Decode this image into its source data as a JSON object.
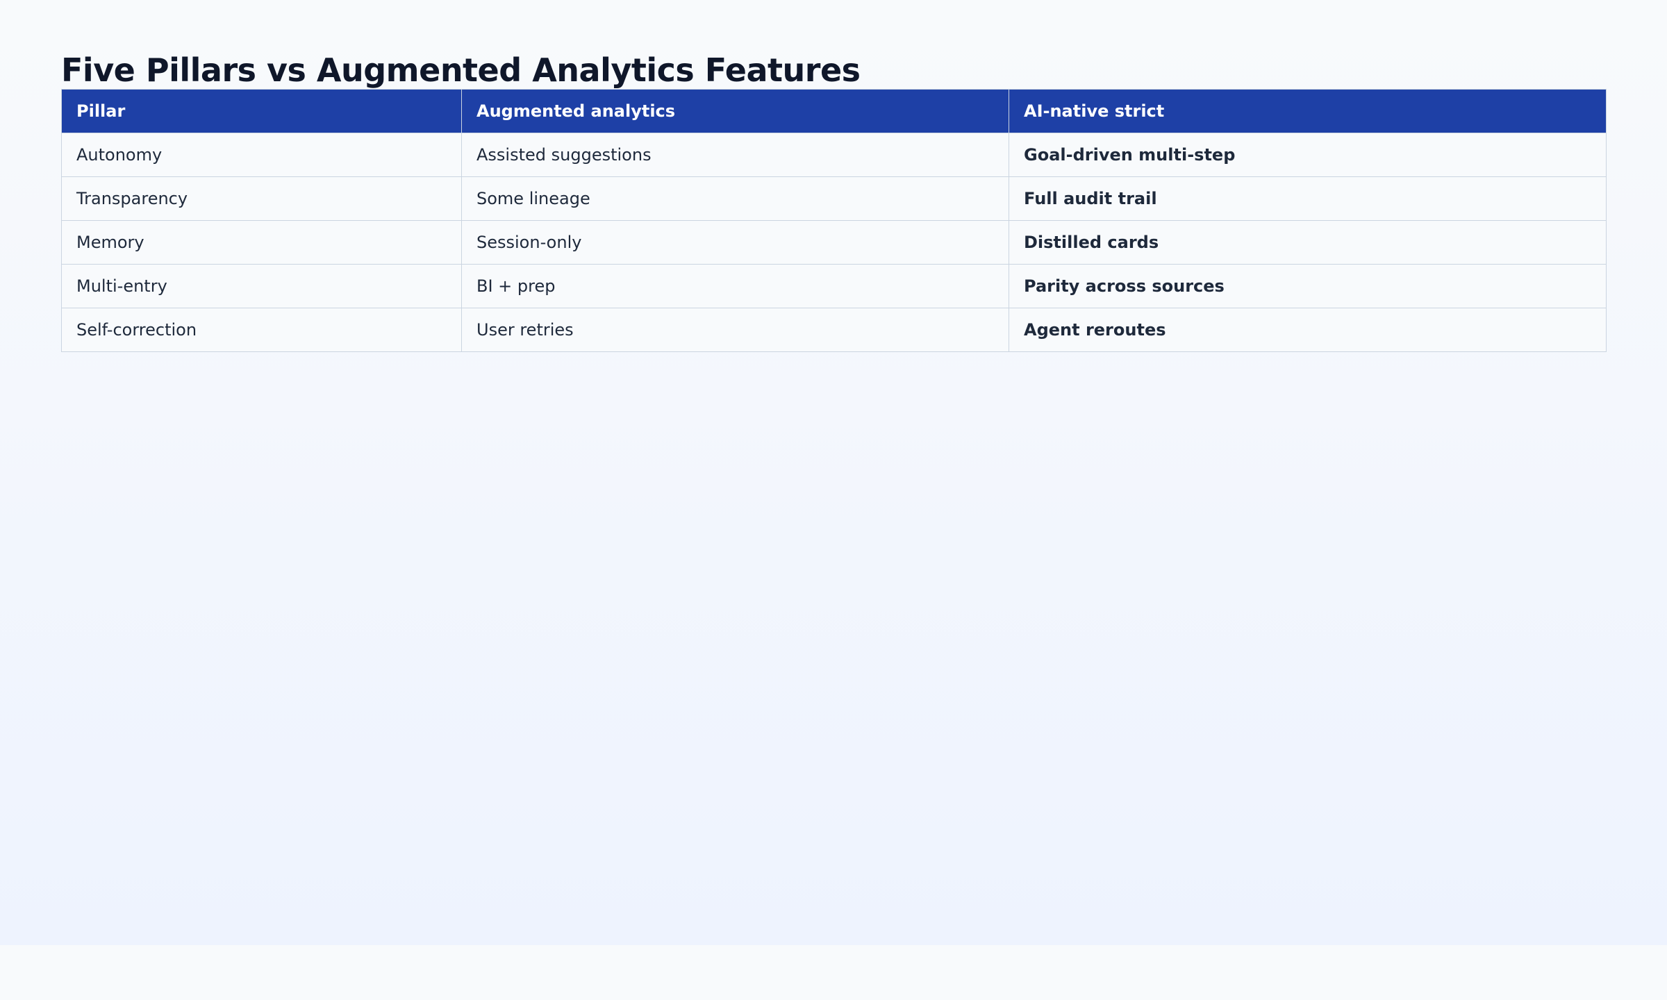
{
  "title": "Five Pillars vs Augmented Analytics Features",
  "columns": [
    "Pillar",
    "Augmented analytics",
    "AI-native strict"
  ],
  "rows": [
    {
      "pillar": "Autonomy",
      "augmented": "Assisted suggestions",
      "augmented_tone": "warn",
      "ai_native": "Goal-driven multi-step"
    },
    {
      "pillar": "Transparency",
      "augmented": "Some lineage",
      "augmented_tone": "warn",
      "ai_native": "Full audit trail"
    },
    {
      "pillar": "Memory",
      "augmented": "Session-only",
      "augmented_tone": "muted",
      "ai_native": "Distilled cards"
    },
    {
      "pillar": "Multi-entry",
      "augmented": "BI + prep",
      "augmented_tone": "warn",
      "ai_native": "Parity across sources"
    },
    {
      "pillar": "Self-correction",
      "augmented": "User retries",
      "augmented_tone": "muted",
      "ai_native": "Agent reroutes"
    }
  ],
  "colors": {
    "header_bg": "#1e40a6",
    "warn": "#b45309",
    "muted": "#64748b",
    "good": "#047857",
    "border": "#cbd5e1"
  }
}
